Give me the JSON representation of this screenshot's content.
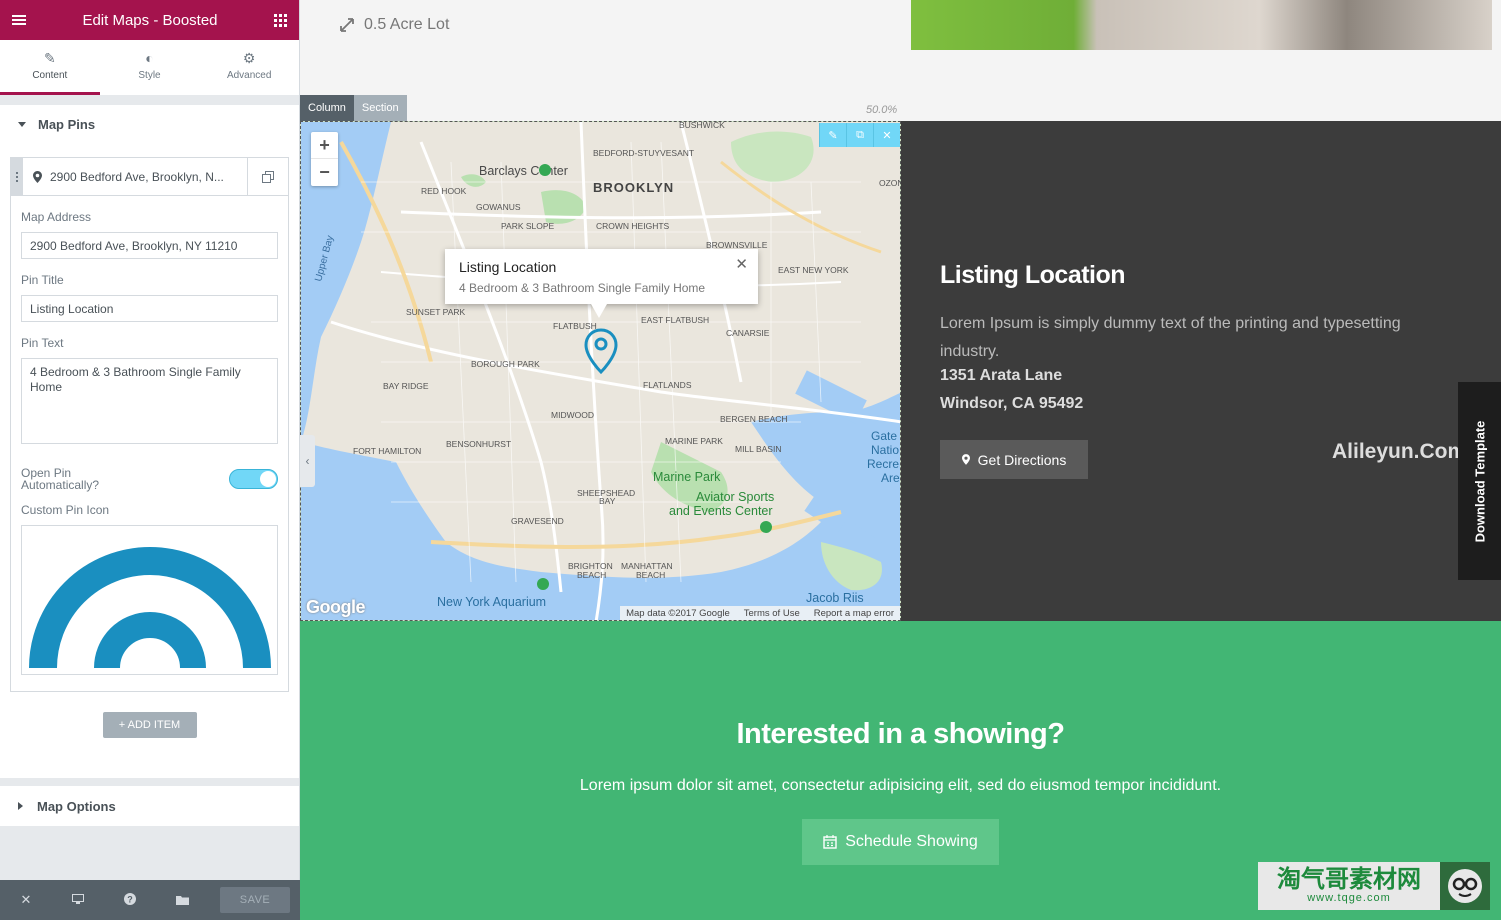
{
  "sidebar": {
    "title": "Edit Maps - Boosted",
    "tabs": [
      {
        "label": "Content",
        "icon": "pencil-icon"
      },
      {
        "label": "Style",
        "icon": "contrast-icon"
      },
      {
        "label": "Advanced",
        "icon": "gear-icon"
      }
    ],
    "section_map_pins": "Map Pins",
    "repeater_item_title": "2900 Bedford Ave, Brooklyn, N...",
    "map_address_label": "Map Address",
    "map_address_value": "2900 Bedford Ave, Brooklyn, NY 11210",
    "pin_title_label": "Pin Title",
    "pin_title_value": "Listing Location",
    "pin_text_label": "Pin Text",
    "pin_text_value": "4 Bedroom & 3 Bathroom Single Family Home",
    "open_pin_label": "Open Pin Automatically?",
    "open_pin_on": true,
    "custom_pin_icon_label": "Custom Pin Icon",
    "add_item_label": "+ ADD ITEM",
    "section_map_options": "Map Options",
    "save_label": "SAVE",
    "colors": {
      "brand": "#a4134d",
      "toggle": "#71d7f7",
      "pin": "#1a8fc0"
    }
  },
  "preview": {
    "lot_size": "0.5 Acre Lot",
    "column_label": "Column",
    "section_label": "Section",
    "width_percent": "50.0%",
    "map": {
      "zoom_in": "+",
      "zoom_out": "−",
      "info_title": "Listing Location",
      "info_text": "4 Bedroom & 3 Bathroom Single Family Home",
      "google_logo": "Google",
      "map_data": "Map data ©2017 Google",
      "terms": "Terms of Use",
      "report": "Report a map error",
      "places": [
        "BUSHWICK",
        "BEDFORD-STUYVESANT",
        "Barclays Center",
        "BROOKLYN",
        "RED HOOK",
        "GOWANUS",
        "PARK SLOPE",
        "CROWN HEIGHTS",
        "BROWNSVILLE",
        "EAST NEW YORK",
        "SUNSET PARK",
        "FLATBUSH",
        "EAST FLATBUSH",
        "CANARSIE",
        "BOROUGH PARK",
        "FLATLANDS",
        "BAY RIDGE",
        "MIDWOOD",
        "BERGEN BEACH",
        "BENSONHURST",
        "MARINE PARK",
        "MILL BASIN",
        "FORT HAMILTON",
        "Marine Park",
        "Aviator Sports and Events Center",
        "SHEEPSHEAD BAY",
        "GRAVESEND",
        "BRIGHTON BEACH",
        "MANHATTAN BEACH",
        "New York Aquarium",
        "Jacob Riis",
        "Upper Bay",
        "OZONE",
        "Gateway National Recreation Area"
      ]
    },
    "listing": {
      "title": "Listing Location",
      "text": "Lorem Ipsum is simply dummy text of the printing and typesetting industry.",
      "address1": "1351 Arata Lane",
      "address2": "Windsor, CA 95492",
      "button": "Get Directions"
    },
    "watermark1": "Alileyun.Com",
    "download_template": "Download Template",
    "cta": {
      "title": "Interested in a showing?",
      "text": "Lorem ipsum dolor sit amet, consectetur adipisicing elit, sed do eiusmod tempor incididunt.",
      "button": "Schedule Showing"
    },
    "watermark2": {
      "line1": "淘气哥素材网",
      "line2": "www.tqge.com"
    },
    "colors": {
      "dark_panel": "#3c3c3c",
      "green": "#42b674"
    }
  }
}
